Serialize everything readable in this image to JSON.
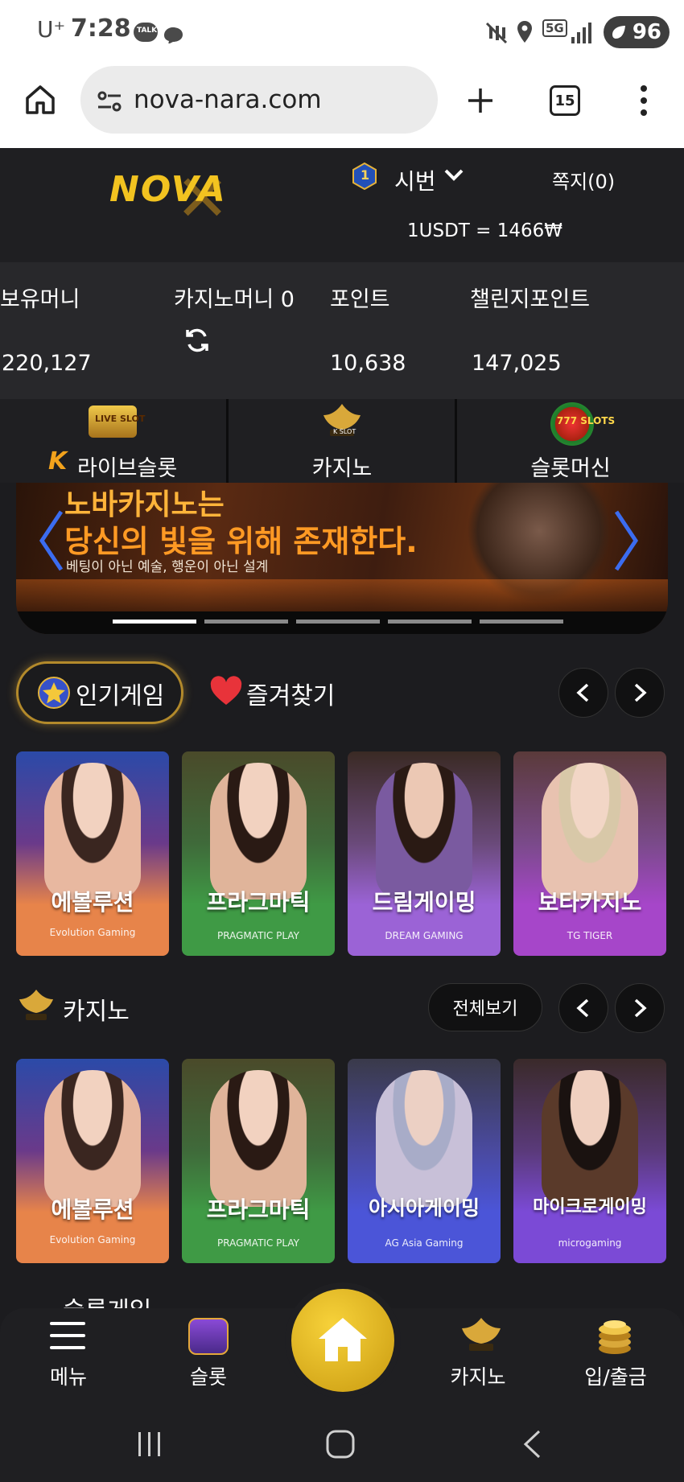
{
  "status_bar": {
    "time": "7:28",
    "carrier": "U⁺",
    "talk_badge": "TALK",
    "network": "5G",
    "battery": "96"
  },
  "browser": {
    "url": "nova-nara.com",
    "tab_count": "15"
  },
  "header": {
    "logo_text": "NOVA",
    "level_badge": "1",
    "user_name": "시번",
    "messages": "쪽지(0)",
    "exchange_rate": "1USDT = 1466₩"
  },
  "balances": {
    "items": [
      {
        "label": "보유머니",
        "value": "220,127"
      },
      {
        "label": "카지노머니 0",
        "value": ""
      },
      {
        "label": "포인트",
        "value": "10,638"
      },
      {
        "label": "챌린지포인트",
        "value": "147,025"
      }
    ]
  },
  "categories": [
    {
      "label": "라이브슬롯",
      "badge": "LIVE SLOT",
      "icon": "live-slot-icon"
    },
    {
      "label": "카지노",
      "badge": "K SLOT",
      "icon": "k-slot-icon"
    },
    {
      "label": "슬롯머신",
      "badge": "777 SLOTS",
      "icon": "slots-777-icon"
    }
  ],
  "banner": {
    "line1": "노바카지노는",
    "line2": "당신의 빛을 위해 존재한다.",
    "line3": "베팅이 아닌 예술, 행운이 아닌 설계",
    "slide_count": 5,
    "active_slide": 1
  },
  "popular": {
    "tab_active": "인기게임",
    "tab_other": "즐겨찾기",
    "games": [
      {
        "name": "에볼루션",
        "brand": "Evolution Gaming",
        "color": "#e7844a"
      },
      {
        "name": "프라그마틱",
        "brand": "PRAGMATIC PLAY",
        "color": "#3f9a45"
      },
      {
        "name": "드림게이밍",
        "brand": "DREAM GAMING",
        "color": "#9b63d6"
      },
      {
        "name": "보타카지노",
        "brand": "TG TIGER",
        "color": "#a646c9"
      }
    ]
  },
  "casino": {
    "title": "카지노",
    "see_all": "전체보기",
    "games": [
      {
        "name": "에볼루션",
        "brand": "Evolution Gaming",
        "color": "#e7844a"
      },
      {
        "name": "프라그마틱",
        "brand": "PRAGMATIC PLAY",
        "color": "#3f9a45"
      },
      {
        "name": "아시아게이밍",
        "brand": "AG Asia Gaming",
        "color": "#4b55d8"
      },
      {
        "name": "마이크로게이밍",
        "brand": "microgaming",
        "color": "#7b4ad6"
      }
    ]
  },
  "next_section_peek": "슬롯게임",
  "bottom_nav": [
    {
      "label": "메뉴",
      "icon": "hamburger-icon"
    },
    {
      "label": "슬롯",
      "icon": "slot-machine-icon"
    },
    {
      "label": "",
      "icon": "home-icon"
    },
    {
      "label": "카지노",
      "icon": "k-slot-icon"
    },
    {
      "label": "입/출금",
      "icon": "coins-icon"
    }
  ],
  "colors": {
    "accent_gold": "#d6a73c",
    "background": "#1c1c1f"
  }
}
